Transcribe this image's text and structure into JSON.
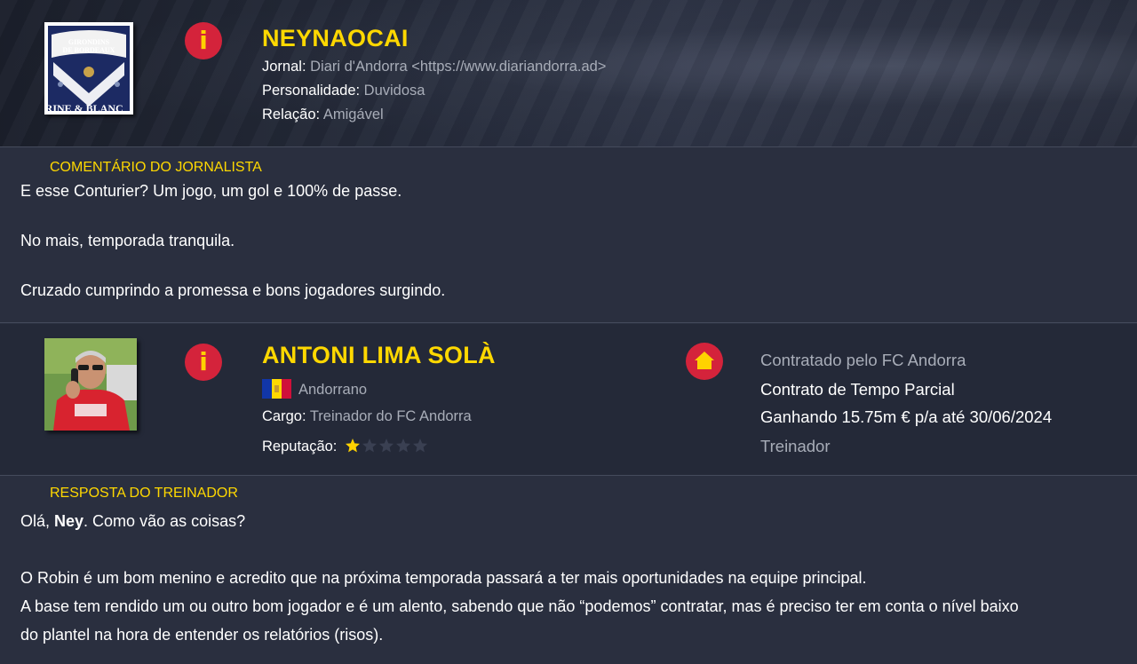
{
  "journalist": {
    "name": "NEYNAOCAI",
    "crest_text_top": [
      "GIRONDINS",
      "DE BORDEAUX"
    ],
    "crest_text_bottom": "ARINE & BLANC",
    "newspaper_label": "Jornal:",
    "newspaper_value": "Diari d'Andorra <https://www.diariandorra.ad>",
    "personality_label": "Personalidade:",
    "personality_value": "Duvidosa",
    "relation_label": "Relação:",
    "relation_value": "Amigável"
  },
  "comment": {
    "title": "COMENTÁRIO DO JORNALISTA",
    "lines": [
      "E esse Conturier? Um jogo, um gol e 100% de passe.",
      "No mais, temporada tranquila.",
      "Cruzado cumprindo a promessa e bons jogadores surgindo."
    ]
  },
  "coach": {
    "name": "ANTONI LIMA SOLÀ",
    "nationality": "Andorrano",
    "role_label": "Cargo:",
    "role_value": "Treinador do FC Andorra",
    "reputation_label": "Reputação:",
    "reputation_stars": 1,
    "reputation_max": 5,
    "contract": {
      "hired_by": "Contratado pelo FC Andorra",
      "type": "Contrato de Tempo Parcial",
      "wage": "Ganhando 15.75m € p/a até 30/06/2024",
      "position": "Treinador"
    }
  },
  "reply": {
    "title": "RESPOSTA DO TREINADOR",
    "greeting_before": "Olá, ",
    "greeting_name": "Ney",
    "greeting_after": ". Como vão as coisas?",
    "lines": [
      "O Robin é um bom menino e acredito que na próxima temporada passará a ter mais oportunidades na equipe principal.",
      "A base tem rendido um ou outro bom jogador e é um alento, sabendo que não “podemos” contratar, mas é preciso ter em conta o nível baixo",
      "do plantel na hora de entender os relatórios (risos)."
    ]
  },
  "colors": {
    "accent_yellow": "#ffd800",
    "icon_red": "#d4233b",
    "muted_text": "#a8adb8",
    "background": "#2a2f3f"
  },
  "icons": [
    "info-icon",
    "home-icon",
    "star-icon",
    "andorra-flag-icon"
  ]
}
